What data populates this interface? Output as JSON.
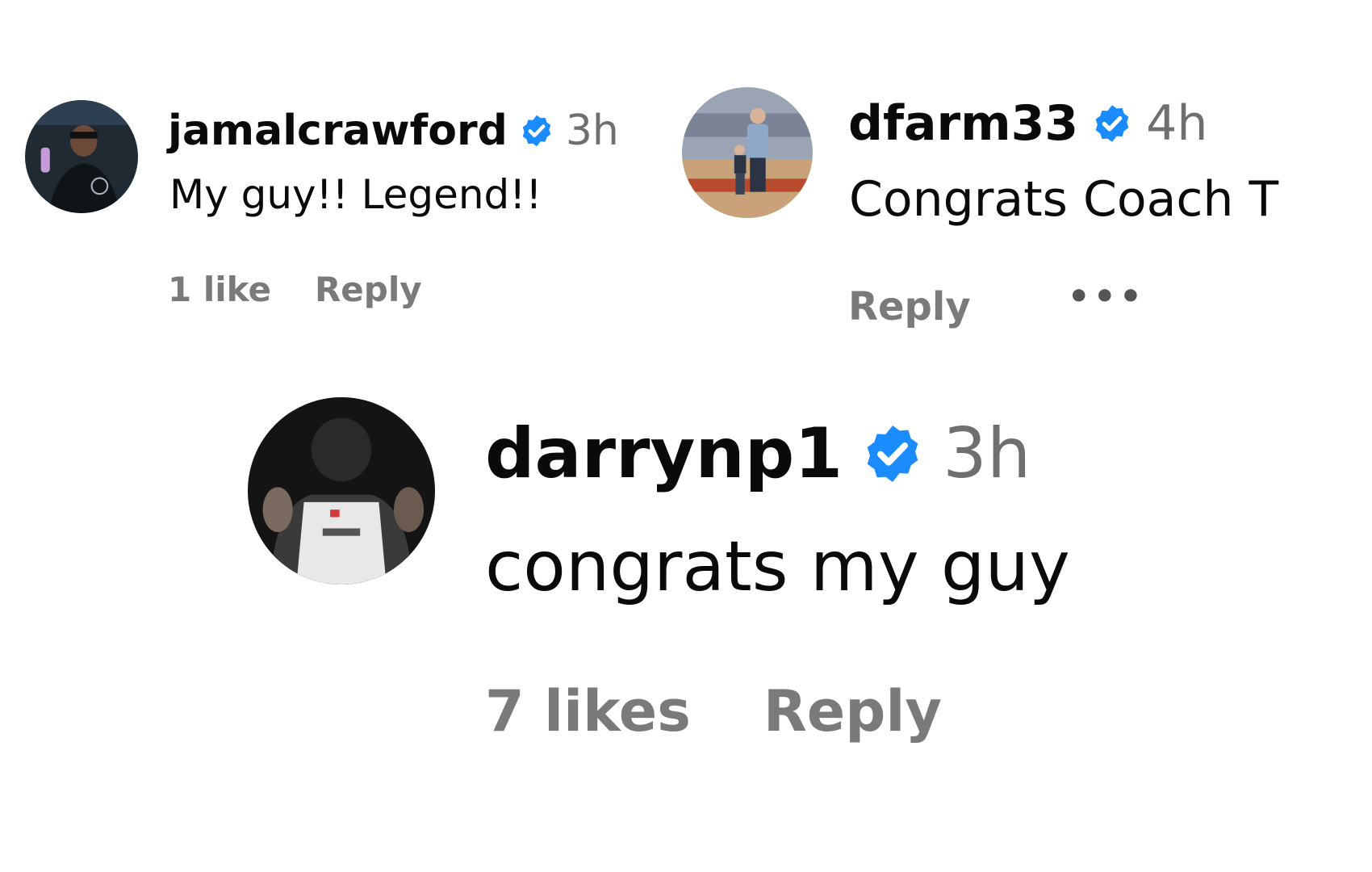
{
  "comments": [
    {
      "username": "jamalcrawford",
      "time": "3h",
      "text": "My guy!! Legend!!",
      "likes": "1 like",
      "reply": "Reply"
    },
    {
      "username": "dfarm33",
      "time": "4h",
      "text": "Congrats Coach T",
      "reply": "Reply",
      "more": "•••"
    },
    {
      "username": "darrynp1",
      "time": "3h",
      "text": "congrats my guy",
      "likes": "7 likes",
      "reply": "Reply"
    }
  ],
  "icons": {
    "verified": "verified-badge-icon",
    "more": "more-options-icon"
  },
  "colors": {
    "verified_blue": "#1a8cff",
    "secondary_text": "#7a7a7a",
    "primary_text": "#0a0a0a"
  }
}
